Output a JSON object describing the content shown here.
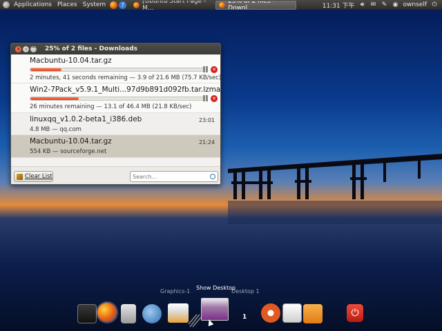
{
  "top_panel": {
    "menus": [
      "Applications",
      "Places",
      "System"
    ],
    "tasks": [
      {
        "label": "[Ubuntu Start Page - M...",
        "active": false
      },
      {
        "label": "25% of 2 files - Downl...",
        "active": true
      }
    ],
    "clock": "11:31 下午",
    "user": "ownself",
    "tray_icons": [
      "volume-icon",
      "mail-icon",
      "chat-icon",
      "user-icon"
    ]
  },
  "downloads_window": {
    "title": "25% of 2 files - Downloads",
    "items": [
      {
        "filename": "Macbuntu-10.04.tar.gz",
        "detail": "2 minutes, 41 seconds remaining — 3.9 of 21.6 MB (75.7 KB/sec)",
        "progress": 0.18,
        "in_progress": true
      },
      {
        "filename": "Win2-7Pack_v5.9.1_Multi...97d9b891d092fb.tar.lzma",
        "detail": "26 minutes remaining — 13.1 of 46.4 MB (21.8 KB/sec)",
        "progress": 0.28,
        "in_progress": true
      },
      {
        "filename": "linuxqq_v1.0.2-beta1_i386.deb",
        "detail": "4.8 MB — qq.com",
        "time": "23:01",
        "in_progress": false
      },
      {
        "filename": "Macbuntu-10.04.tar.gz",
        "detail": "554 KB — sourceforge.net",
        "time": "21:24",
        "in_progress": false
      }
    ],
    "clear_button": "Clear List",
    "search_placeholder": "Search..."
  },
  "dock": {
    "workspace_labels": [
      "Graphics-1",
      "Desktop 1"
    ],
    "hover_label": "Show Desktop",
    "workspace_number": "1"
  }
}
